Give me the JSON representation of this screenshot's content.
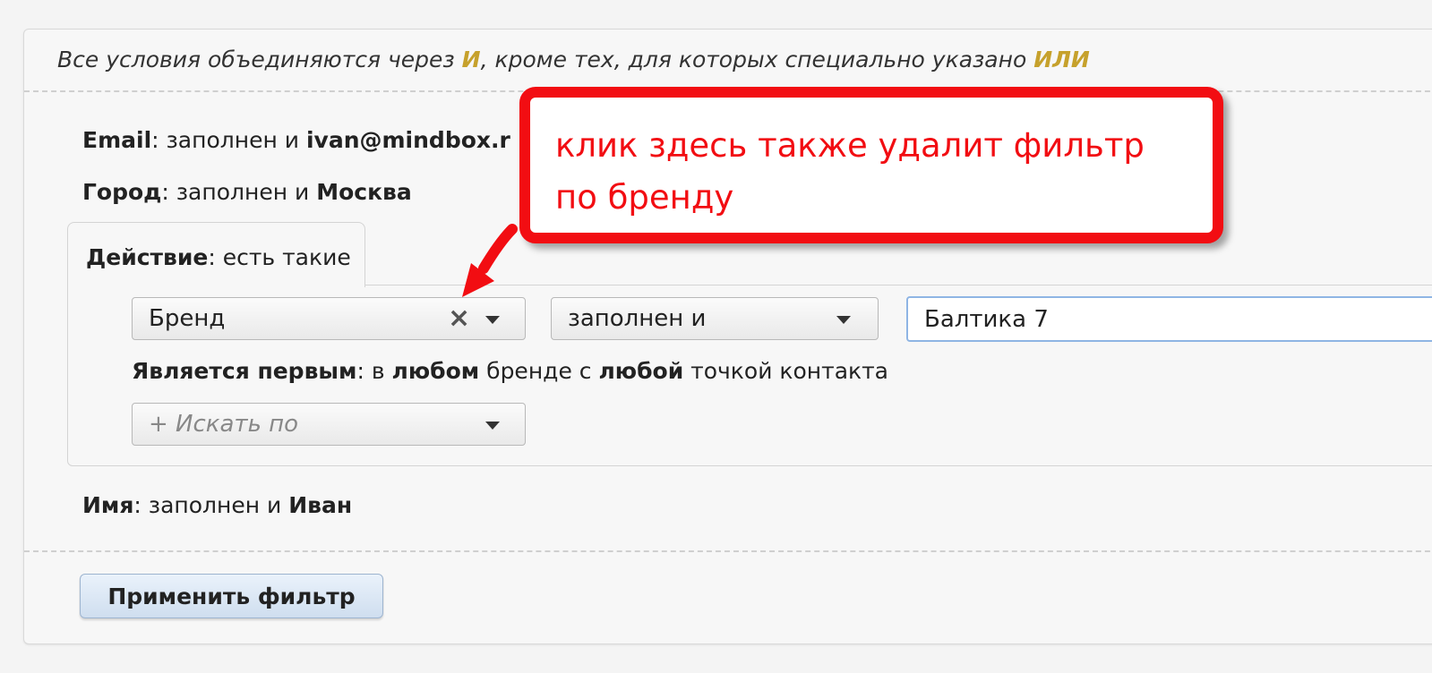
{
  "header_note": {
    "text_before": "Все условия объединяются через ",
    "and_kw": "И",
    "text_middle": ", кроме тех, для которых специально указано ",
    "or_kw": "ИЛИ"
  },
  "conditions": {
    "email": {
      "label": "Email",
      "sep": ": заполнен и ",
      "value": "ivan@mindbox.r"
    },
    "city": {
      "label": "Город",
      "sep": ": заполнен и ",
      "value": "Москва"
    },
    "name": {
      "label": "Имя",
      "sep": ": заполнен и ",
      "value": "Иван"
    }
  },
  "action": {
    "tab_label": "Действие",
    "tab_value": ": есть такие",
    "field_select": {
      "value": "Бренд",
      "clear_icon": "×"
    },
    "operator_select": {
      "value": "заполнен и"
    },
    "value_input": {
      "value": "Балтика 7"
    },
    "first_note": {
      "label": "Является первым",
      "t1": ": в ",
      "b1": "любом",
      "t2": " бренде с ",
      "b2": "любой",
      "t3": " точкой контакта"
    },
    "search_select": {
      "placeholder": "+ Искать по"
    }
  },
  "apply_button": {
    "label": "Применить фильтр"
  },
  "callout": {
    "line1": "клик здесь также удалит фильтр",
    "line2": "по бренду"
  },
  "colors": {
    "keyword": "#c6a12c",
    "callout_red": "#f20d12",
    "input_focus": "#8fb5e4",
    "button_bg": "#cfdeef"
  }
}
